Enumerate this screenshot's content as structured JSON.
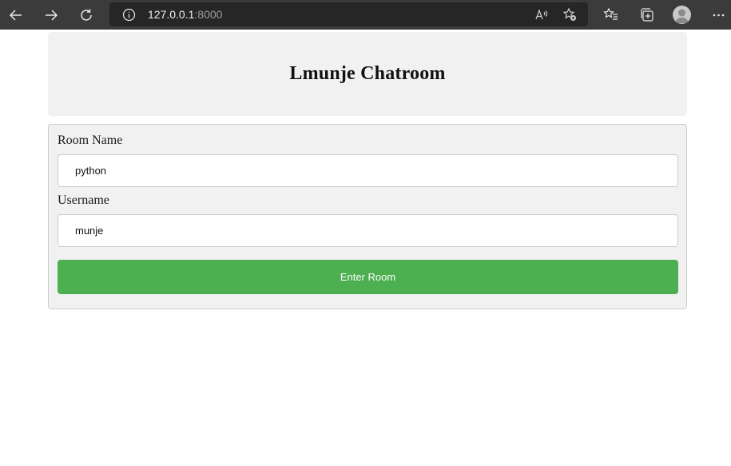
{
  "browser": {
    "address_host": "127.0.0.1",
    "address_port": ":8000"
  },
  "page": {
    "title": "Lmunje Chatroom"
  },
  "form": {
    "room_label": "Room Name",
    "room_value": "python",
    "username_label": "Username",
    "username_value": "munje",
    "submit_label": "Enter Room"
  },
  "colors": {
    "browser_bar": "#3b3b3b",
    "panel_bg": "#f1f1f1",
    "button_green": "#4caf50"
  },
  "icons": [
    "back-arrow-icon",
    "forward-arrow-icon",
    "refresh-icon",
    "info-icon",
    "read-aloud-icon",
    "add-favorite-icon",
    "favorites-icon",
    "collections-icon",
    "profile-avatar-icon",
    "more-options-icon"
  ]
}
